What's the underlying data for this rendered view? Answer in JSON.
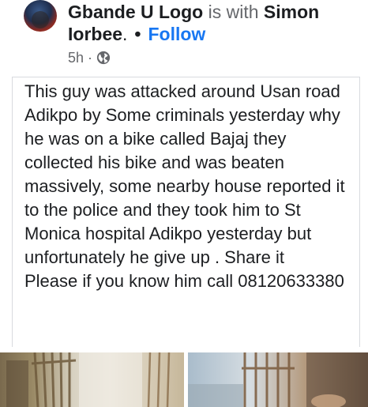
{
  "post": {
    "author": "Gbande U Logo",
    "with_text": "is with",
    "tagged_first": "Simon",
    "tagged_last": "Iorbee",
    "tagged_suffix": ".",
    "separator": "•",
    "follow_label": "Follow",
    "time": "5h",
    "meta_separator": "·",
    "privacy_icon": "globe-icon",
    "body": "This guy was attacked around Usan road Adikpo by Some criminals yesterday why he was on a bike called Bajaj they collected his bike and was beaten massively, some nearby house reported it to the police and they took him to St Monica hospital Adikpo yesterday but unfortunately he give up . Share it\nPlease if you know him call 08120633380"
  },
  "colors": {
    "link": "#1877f2",
    "meta": "#65676b",
    "text": "#1c1e21"
  }
}
